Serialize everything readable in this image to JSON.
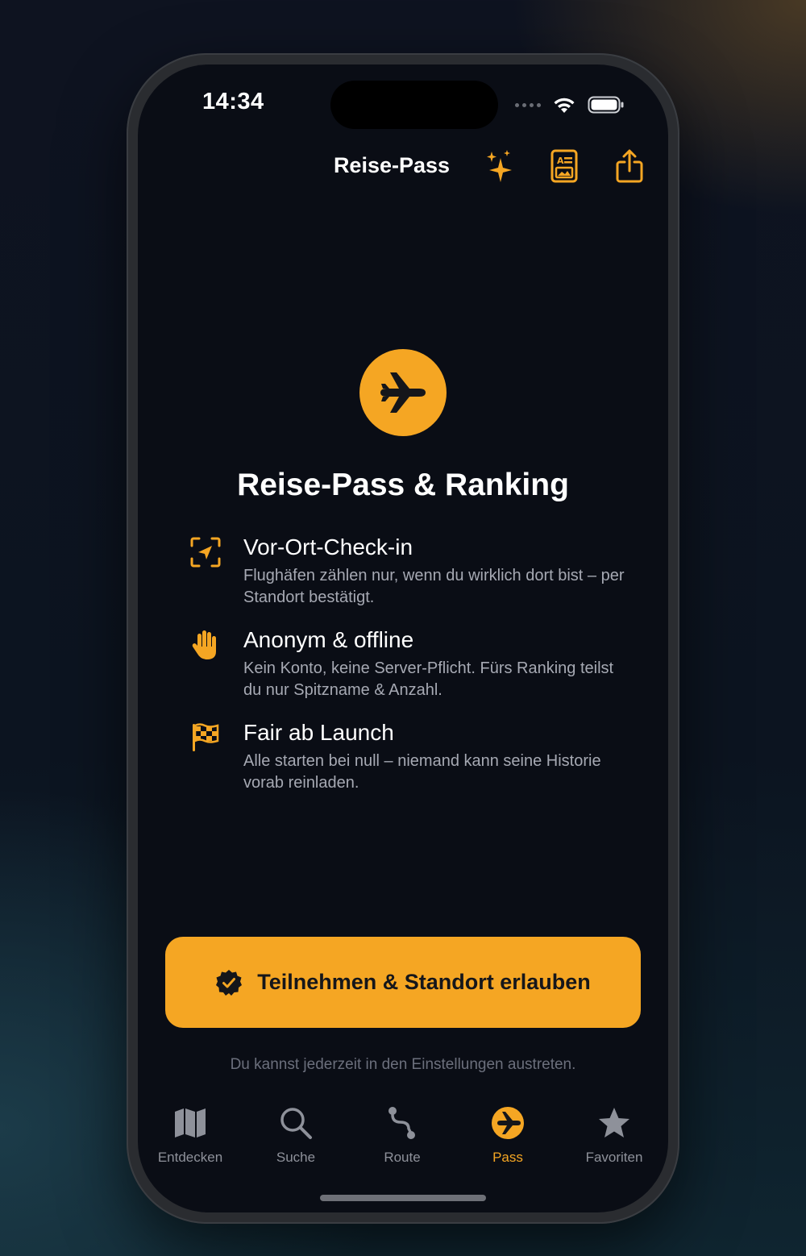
{
  "status_bar": {
    "time": "14:34"
  },
  "nav": {
    "title": "Reise-Pass",
    "actions": [
      "sparkles-icon",
      "id-card-icon",
      "share-icon"
    ]
  },
  "hero": {
    "icon": "airplane-icon",
    "title": "Reise-Pass & Ranking"
  },
  "features": [
    {
      "icon": "location-viewfinder-icon",
      "title": "Vor-Ort-Check-in",
      "description": "Flughäfen zählen nur, wenn du wirklich dort bist – per Standort bestätigt."
    },
    {
      "icon": "raised-hand-icon",
      "title": "Anonym & offline",
      "description": "Kein Konto, keine Server-Pflicht. Fürs Ranking teilst du nur Spitzname & Anzahl."
    },
    {
      "icon": "checkered-flag-icon",
      "title": "Fair ab Launch",
      "description": "Alle starten bei null – niemand kann seine Historie vorab reinladen."
    }
  ],
  "cta": {
    "label": "Teilnehmen & Standort erlauben",
    "icon": "checkmark-seal-icon"
  },
  "footnote": "Du kannst jederzeit in den Einstellungen austreten.",
  "tabs": [
    {
      "label": "Entdecken",
      "icon": "map-icon",
      "active": false
    },
    {
      "label": "Suche",
      "icon": "search-icon",
      "active": false
    },
    {
      "label": "Route",
      "icon": "route-icon",
      "active": false
    },
    {
      "label": "Pass",
      "icon": "airplane-circle-icon",
      "active": true
    },
    {
      "label": "Favoriten",
      "icon": "star-icon",
      "active": false
    }
  ],
  "colors": {
    "accent": "#f5a623",
    "background": "#0a0d15",
    "inactive": "#8e919a"
  }
}
